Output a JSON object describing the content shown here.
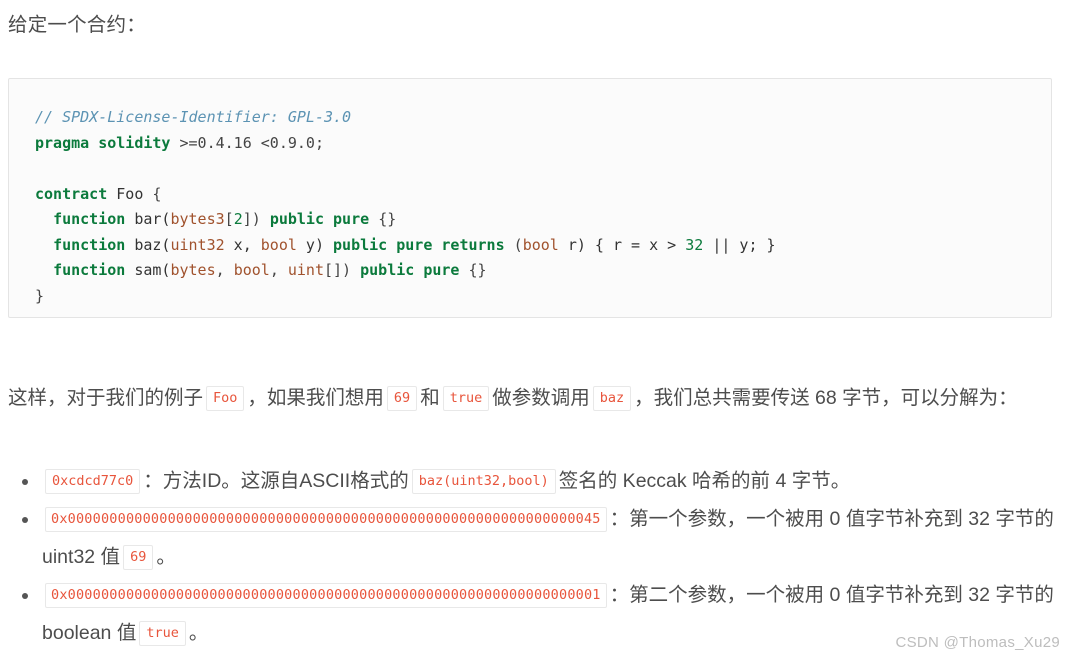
{
  "intro": {
    "text": "给定一个合约："
  },
  "code_block": {
    "language": "solidity",
    "lines": [
      {
        "id": "l1",
        "text": "// SPDX-License-Identifier: GPL-3.0"
      },
      {
        "id": "l2",
        "text": "pragma solidity >=0.4.16 <0.9.0;"
      },
      {
        "id": "l3",
        "text": ""
      },
      {
        "id": "l4",
        "text": "contract Foo {"
      },
      {
        "id": "l5",
        "text": "  function bar(bytes3[2]) public pure {}"
      },
      {
        "id": "l6",
        "text": "  function baz(uint32 x, bool y) public pure returns (bool r) { r = x > 32 || y; }"
      },
      {
        "id": "l7",
        "text": "  function sam(bytes, bool, uint[]) public pure {}"
      },
      {
        "id": "l8",
        "text": "}"
      }
    ],
    "tokens": {
      "comment": "// SPDX-License-Identifier: GPL-3.0",
      "pragma_kw": "pragma",
      "solidity_kw": "solidity",
      "pragma_version": ">=0.4.16 <0.9.0;",
      "contract_kw": "contract",
      "contract_name": "Foo",
      "open_brace": "{",
      "close_brace": "}",
      "function_kw": "function",
      "fn_bar_name": "bar(",
      "fn_bar_type": "bytes3",
      "fn_bar_idx_open": "[",
      "fn_bar_idx": "2",
      "fn_bar_idx_close": "])",
      "public_kw": "public",
      "pure_kw": "pure",
      "empty_body": "{}",
      "fn_baz_name": "baz(",
      "fn_baz_t1": "uint32",
      "fn_baz_a1": " x, ",
      "fn_baz_t2": "bool",
      "fn_baz_a2": " y)",
      "returns_kw": "returns",
      "ret_open": "(",
      "ret_type": "bool",
      "ret_name": " r) { r = x > ",
      "ret_num": "32",
      "ret_tail": " || y; }",
      "fn_sam_name": "sam(",
      "fn_sam_t1": "bytes",
      "fn_sam_sep1": ", ",
      "fn_sam_t2": "bool",
      "fn_sam_sep2": ", ",
      "fn_sam_t3": "uint",
      "fn_sam_t3_arr": "[])"
    }
  },
  "paragraph": {
    "part1": "这样，对于我们的例子",
    "chip_foo": "Foo",
    "part2": "，如果我们想用",
    "chip_69": "69",
    "part3": "和",
    "chip_true": "true",
    "part4": "做参数调用",
    "chip_baz": "baz",
    "part5": "，我们总共需要传送 68 字节，可以分解为："
  },
  "bullets": [
    {
      "id": "bullet-method-id",
      "chip": "0xcdcd77c0",
      "text_before_inline": "：方法ID。这源自ASCII格式的",
      "inline_chip": "baz(uint32,bool)",
      "text_after_inline": "签名的 Keccak 哈希的前 4 字节。",
      "trailing_chip": null,
      "trailing_text": null
    },
    {
      "id": "bullet-first-arg",
      "chip": "0x0000000000000000000000000000000000000000000000000000000000000045",
      "text_before_inline": "：第一个参数，一个被用 0 值字节补充到 32 字节的 uint32 值",
      "inline_chip": null,
      "text_after_inline": null,
      "trailing_chip": "69",
      "trailing_text": "。"
    },
    {
      "id": "bullet-second-arg",
      "chip": "0x0000000000000000000000000000000000000000000000000000000000000001",
      "text_before_inline": "：第二个参数，一个被用 0 值字节补充到 32 字节的 boolean 值",
      "inline_chip": null,
      "text_after_inline": null,
      "trailing_chip": "true",
      "trailing_text": "。"
    }
  ],
  "watermark": {
    "text": "CSDN @Thomas_Xu29"
  },
  "colors": {
    "text": "#4d4d4d",
    "chip_text": "#e8553c",
    "chip_border": "#e8e8e8",
    "code_bg": "#fbfbfb",
    "code_border": "#e4e4e4",
    "keyword": "#0b7a3c",
    "type": "#a0522d",
    "comment": "#5c93b3",
    "watermark": "#bdbdbd"
  }
}
